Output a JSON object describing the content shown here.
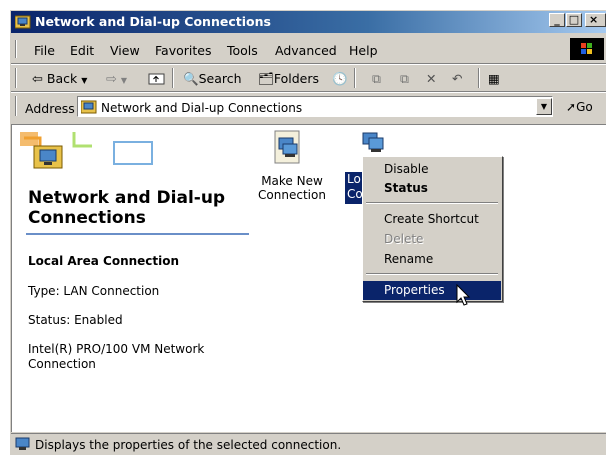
{
  "window": {
    "title": "Network and Dial-up Connections",
    "controls": {
      "minimize": "_",
      "maximize": "□",
      "close": "×"
    }
  },
  "menubar": [
    "File",
    "Edit",
    "View",
    "Favorites",
    "Tools",
    "Advanced",
    "Help"
  ],
  "toolbar": {
    "back": "Back",
    "search": "Search",
    "folders": "Folders"
  },
  "address": {
    "label": "Address",
    "value": "Network and Dial-up Connections",
    "go": "Go"
  },
  "sidepanel": {
    "heading_line1": "Network and Dial-up",
    "heading_line2": "Connections",
    "selected_title": "Local Area Connection",
    "type": "Type: LAN Connection",
    "status": "Status: Enabled",
    "device_line1": "Intel(R) PRO/100 VM Network",
    "device_line2": "Connection"
  },
  "icons": [
    {
      "label_line1": "Make New",
      "label_line2": "Connection",
      "icon": "make-new-connection-icon"
    },
    {
      "label_line1": "Lo",
      "label_line2": "Co",
      "icon": "lan-connection-icon"
    }
  ],
  "context_menu": {
    "items": [
      {
        "label": "Disable",
        "bold": false,
        "disabled": false
      },
      {
        "label": "Status",
        "bold": true,
        "disabled": false
      },
      {
        "label": "Create Shortcut",
        "bold": false,
        "disabled": false
      },
      {
        "label": "Delete",
        "bold": false,
        "disabled": true
      },
      {
        "label": "Rename",
        "bold": false,
        "disabled": false
      },
      {
        "label": "Properties",
        "bold": false,
        "disabled": false,
        "highlighted": true
      }
    ]
  },
  "statusbar": {
    "text": "Displays the properties of the selected connection."
  },
  "colors": {
    "titlebar_start": "#0a246a",
    "titlebar_end": "#a6caf0",
    "highlight": "#0a246a",
    "disabled_text": "#808080",
    "face": "#d4d0c8"
  }
}
